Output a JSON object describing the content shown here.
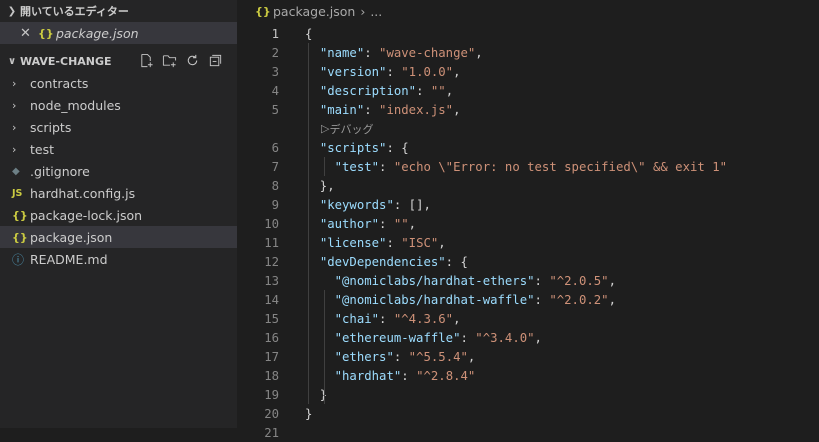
{
  "sidebar": {
    "open_editors_title": "開いているエディター",
    "open_editor_file": "package.json",
    "project_title": "WAVE-CHANGE",
    "items": [
      {
        "label": "contracts"
      },
      {
        "label": "node_modules"
      },
      {
        "label": "scripts"
      },
      {
        "label": "test"
      },
      {
        "label": ".gitignore"
      },
      {
        "label": "hardhat.config.js"
      },
      {
        "label": "package-lock.json"
      },
      {
        "label": "package.json"
      },
      {
        "label": "README.md"
      }
    ]
  },
  "editor": {
    "breadcrumb_file": "package.json",
    "breadcrumb_more": "...",
    "codelens": "デバッグ",
    "lines": [
      {
        "n": "1",
        "t": [
          [
            "p",
            "{"
          ]
        ]
      },
      {
        "n": "2",
        "t": [
          [
            "p",
            "  "
          ],
          [
            "k",
            "\"name\""
          ],
          [
            "p",
            ": "
          ],
          [
            "s",
            "\"wave-change\""
          ],
          [
            "p",
            ","
          ]
        ]
      },
      {
        "n": "3",
        "t": [
          [
            "p",
            "  "
          ],
          [
            "k",
            "\"version\""
          ],
          [
            "p",
            ": "
          ],
          [
            "s",
            "\"1.0.0\""
          ],
          [
            "p",
            ","
          ]
        ]
      },
      {
        "n": "4",
        "t": [
          [
            "p",
            "  "
          ],
          [
            "k",
            "\"description\""
          ],
          [
            "p",
            ": "
          ],
          [
            "s",
            "\"\""
          ],
          [
            "p",
            ","
          ]
        ]
      },
      {
        "n": "5",
        "t": [
          [
            "p",
            "  "
          ],
          [
            "k",
            "\"main\""
          ],
          [
            "p",
            ": "
          ],
          [
            "s",
            "\"index.js\""
          ],
          [
            "p",
            ","
          ]
        ]
      },
      {
        "n": "6",
        "t": [
          [
            "p",
            "  "
          ],
          [
            "k",
            "\"scripts\""
          ],
          [
            "p",
            ": {"
          ]
        ]
      },
      {
        "n": "7",
        "t": [
          [
            "p",
            "    "
          ],
          [
            "k",
            "\"test\""
          ],
          [
            "p",
            ": "
          ],
          [
            "s",
            "\"echo \\\"Error: no test specified\\\" && exit 1\""
          ]
        ]
      },
      {
        "n": "8",
        "t": [
          [
            "p",
            "  },"
          ]
        ]
      },
      {
        "n": "9",
        "t": [
          [
            "p",
            "  "
          ],
          [
            "k",
            "\"keywords\""
          ],
          [
            "p",
            ": [],"
          ]
        ]
      },
      {
        "n": "10",
        "t": [
          [
            "p",
            "  "
          ],
          [
            "k",
            "\"author\""
          ],
          [
            "p",
            ": "
          ],
          [
            "s",
            "\"\""
          ],
          [
            "p",
            ","
          ]
        ]
      },
      {
        "n": "11",
        "t": [
          [
            "p",
            "  "
          ],
          [
            "k",
            "\"license\""
          ],
          [
            "p",
            ": "
          ],
          [
            "s",
            "\"ISC\""
          ],
          [
            "p",
            ","
          ]
        ]
      },
      {
        "n": "12",
        "t": [
          [
            "p",
            "  "
          ],
          [
            "k",
            "\"devDependencies\""
          ],
          [
            "p",
            ": {"
          ]
        ]
      },
      {
        "n": "13",
        "t": [
          [
            "p",
            "    "
          ],
          [
            "k",
            "\"@nomiclabs/hardhat-ethers\""
          ],
          [
            "p",
            ": "
          ],
          [
            "s",
            "\"^2.0.5\""
          ],
          [
            "p",
            ","
          ]
        ]
      },
      {
        "n": "14",
        "t": [
          [
            "p",
            "    "
          ],
          [
            "k",
            "\"@nomiclabs/hardhat-waffle\""
          ],
          [
            "p",
            ": "
          ],
          [
            "s",
            "\"^2.0.2\""
          ],
          [
            "p",
            ","
          ]
        ]
      },
      {
        "n": "15",
        "t": [
          [
            "p",
            "    "
          ],
          [
            "k",
            "\"chai\""
          ],
          [
            "p",
            ": "
          ],
          [
            "s",
            "\"^4.3.6\""
          ],
          [
            "p",
            ","
          ]
        ]
      },
      {
        "n": "16",
        "t": [
          [
            "p",
            "    "
          ],
          [
            "k",
            "\"ethereum-waffle\""
          ],
          [
            "p",
            ": "
          ],
          [
            "s",
            "\"^3.4.0\""
          ],
          [
            "p",
            ","
          ]
        ]
      },
      {
        "n": "17",
        "t": [
          [
            "p",
            "    "
          ],
          [
            "k",
            "\"ethers\""
          ],
          [
            "p",
            ": "
          ],
          [
            "s",
            "\"^5.5.4\""
          ],
          [
            "p",
            ","
          ]
        ]
      },
      {
        "n": "18",
        "t": [
          [
            "p",
            "    "
          ],
          [
            "k",
            "\"hardhat\""
          ],
          [
            "p",
            ": "
          ],
          [
            "s",
            "\"^2.8.4\""
          ]
        ]
      },
      {
        "n": "19",
        "t": [
          [
            "p",
            "  }"
          ]
        ]
      },
      {
        "n": "20",
        "t": [
          [
            "p",
            "}"
          ]
        ]
      },
      {
        "n": "21",
        "t": []
      }
    ]
  }
}
